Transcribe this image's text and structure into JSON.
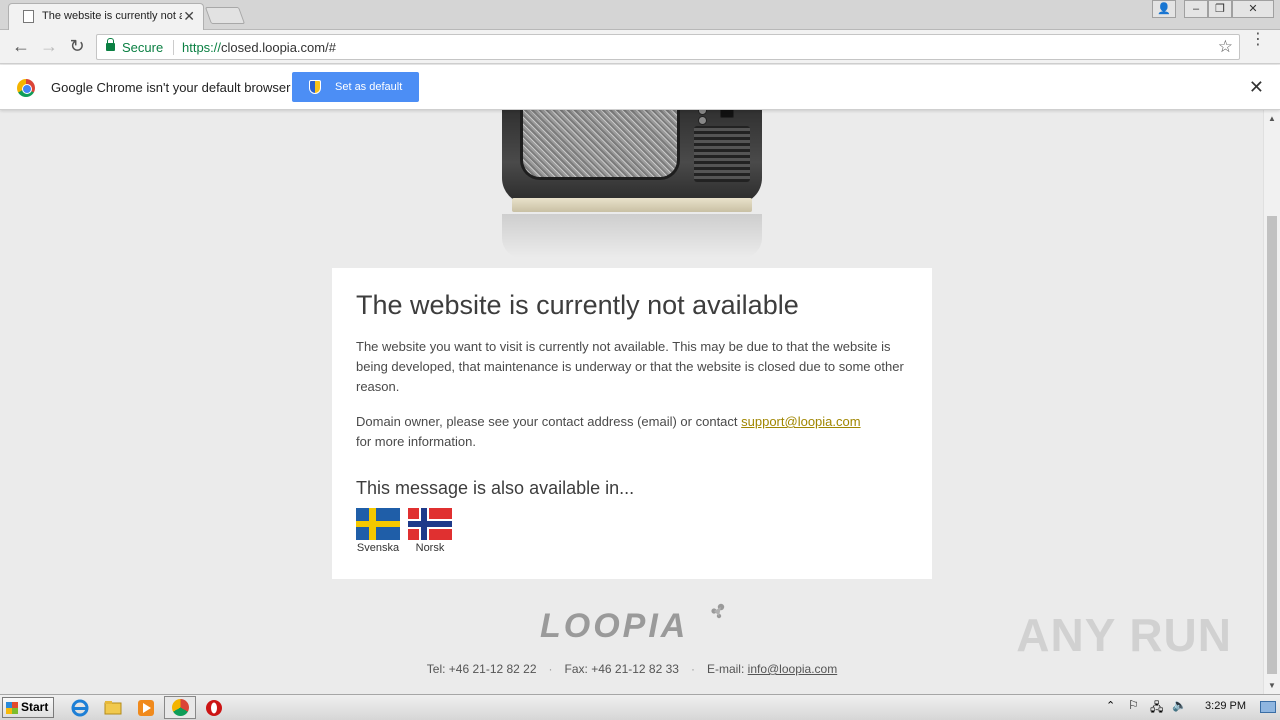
{
  "browser": {
    "tab_title": "The website is currently not available",
    "address": {
      "secure_label": "Secure",
      "protocol": "https://",
      "rest": "closed.loopia.com/#"
    },
    "infobar": {
      "text": "Google Chrome isn't your default browser",
      "button": "Set as default"
    }
  },
  "page": {
    "heading": "The website is currently not available",
    "paragraph1": "The website you want to visit is currently not available. This may be due to that the website is being developed, that maintenance is underway or that the website is closed due to some other reason.",
    "paragraph2_prefix": "Domain owner, please see your contact address (email) or contact ",
    "support_email": "support@loopia.com",
    "paragraph2_suffix": "for more information.",
    "languages_heading": "This message is also available in...",
    "languages": [
      {
        "label": "Svenska"
      },
      {
        "label": "Norsk"
      }
    ],
    "logo_text": "LOOPIA",
    "footer": {
      "tel": "Tel: +46 21-12 82 22",
      "fax": "Fax: +46 21-12 82 33",
      "email_label": "E-mail:",
      "email": "info@loopia.com"
    }
  },
  "watermark": "ANY RUN",
  "taskbar": {
    "start": "Start",
    "clock": "3:29 PM"
  }
}
